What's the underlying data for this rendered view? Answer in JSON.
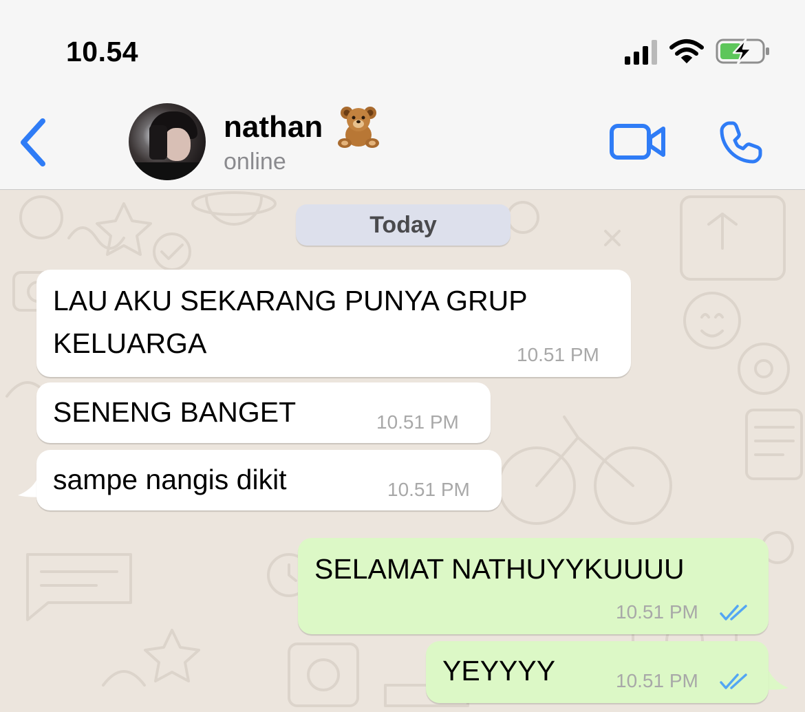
{
  "status_bar": {
    "time": "10.54",
    "icons": [
      "cellular-signal-icon",
      "wifi-icon",
      "battery-charging-icon"
    ]
  },
  "header": {
    "contact_name": "nathan",
    "contact_emoji": "🧸",
    "contact_status": "online",
    "icons": [
      "back-chevron-icon",
      "video-call-icon",
      "phone-call-icon"
    ],
    "accent_color": "#2f7cf6"
  },
  "chat": {
    "date_label": "Today",
    "messages": [
      {
        "direction": "incoming",
        "lines": [
          "LAU AKU SEKARANG PUNYA GRUP",
          "KELUARGA"
        ],
        "time": "10.51 PM"
      },
      {
        "direction": "incoming",
        "lines": [
          "SENENG BANGET"
        ],
        "time": "10.51 PM"
      },
      {
        "direction": "incoming",
        "lines": [
          "sampe nangis dikit"
        ],
        "time": "10.51 PM"
      },
      {
        "direction": "outgoing",
        "lines": [
          "SELAMAT NATHUYYKUUUU"
        ],
        "time": "10.51 PM",
        "status": "read"
      },
      {
        "direction": "outgoing",
        "lines": [
          "YEYYYY"
        ],
        "time": "10.51 PM",
        "status": "read"
      }
    ],
    "colors": {
      "background": "#ece5dd",
      "incoming_bubble": "#ffffff",
      "outgoing_bubble": "#dcf8c6",
      "read_ticks": "#53a6f3"
    }
  }
}
